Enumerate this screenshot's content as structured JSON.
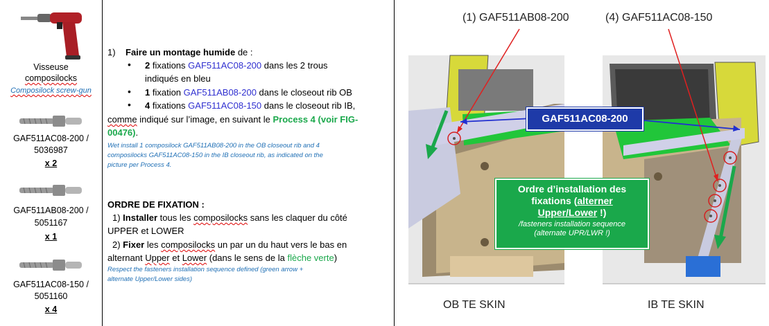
{
  "tools": {
    "screw_gun": {
      "name_fr_line1": "Visseuse",
      "name_fr_line2": "composilocks",
      "name_en": "Composilock screw-gun"
    },
    "parts": [
      {
        "line1": "GAF511AC08-200 /",
        "line2": "5036987",
        "qty": "x 2"
      },
      {
        "line1": "GAF511AB08-200 /",
        "line2": "5051167",
        "qty": "x 1"
      },
      {
        "line1": "GAF511AC08-150 /",
        "line2": "5051160",
        "qty": "x 4"
      }
    ]
  },
  "instructions": {
    "step1_num": "1)",
    "step1_title": "Faire un montage humide",
    "step1_suffix": " de :",
    "b1_qty": "2",
    "b1_text_a": " fixations ",
    "b1_part": "GAF511AC08-200",
    "b1_text_b": " dans les 2 trous",
    "b1_text_c": "indiqués en bleu",
    "b2_qty": "1",
    "b2_text_a": " fixation ",
    "b2_part": "GAF511AB08-200",
    "b2_text_b": " dans le closeout rib OB",
    "b3_qty": "4",
    "b3_text_a": " fixations ",
    "b3_part": "GAF511AC08-150",
    "b3_text_b": " dans le closeout rib IB,",
    "line_comme_a": "comme",
    "line_comme_b": " indiqué sur l’image, en suivant le ",
    "process_ref_a": "Process 4 (voir FIG-",
    "process_ref_b": "00476)",
    "process_ref_end": ".",
    "english_1": "Wet install 1 composilock GAF511AB08-200 in the OB closeout rib and 4",
    "english_2": "composilocks GAF511AC08-150 in the IB closeout rib, as indicated on the",
    "english_3": "picture per Process 4.",
    "order_title": "ORDRE DE FIXATION :",
    "o1_num": "1) ",
    "o1_bold": "Installer",
    "o1_text_a": " tous les ",
    "o1_word": "composilocks",
    "o1_text_b": " sans les claquer du côté",
    "o1_text_c": "UPPER et LOWER",
    "o2_num": "2) ",
    "o2_bold": "Fixer",
    "o2_text_a": " les ",
    "o2_word": "composilocks",
    "o2_text_b": " un par un du haut vers le bas en",
    "o2_text_c": "alternant ",
    "o2_upper": "Upper",
    "o2_et": " et ",
    "o2_lower": "Lower",
    "o2_text_d": " (dans le sens de la ",
    "o2_arrow": "flèche verte",
    "o2_text_e": ")",
    "english_4": "Respect the fasteners installation sequence defined (green arrow +",
    "english_5": "alternate Upper/Lower sides)"
  },
  "figure": {
    "label_ab": "(1) GAF511AB08-200",
    "label_ac150": "(4) GAF511AC08-150",
    "callout_blue": "GAF511AC08-200",
    "order_fr_1": "Ordre d’installation des",
    "order_fr_2": "fixations (",
    "order_fr_3": "alterner",
    "order_fr_4": "Upper/Lower",
    "order_fr_5": " !)",
    "order_en_1": "/fasteners installation sequence",
    "order_en_2": "(alternate UPR/LWR !)",
    "caption_left": "OB TE SKIN",
    "caption_right": "IB TE SKIN"
  }
}
